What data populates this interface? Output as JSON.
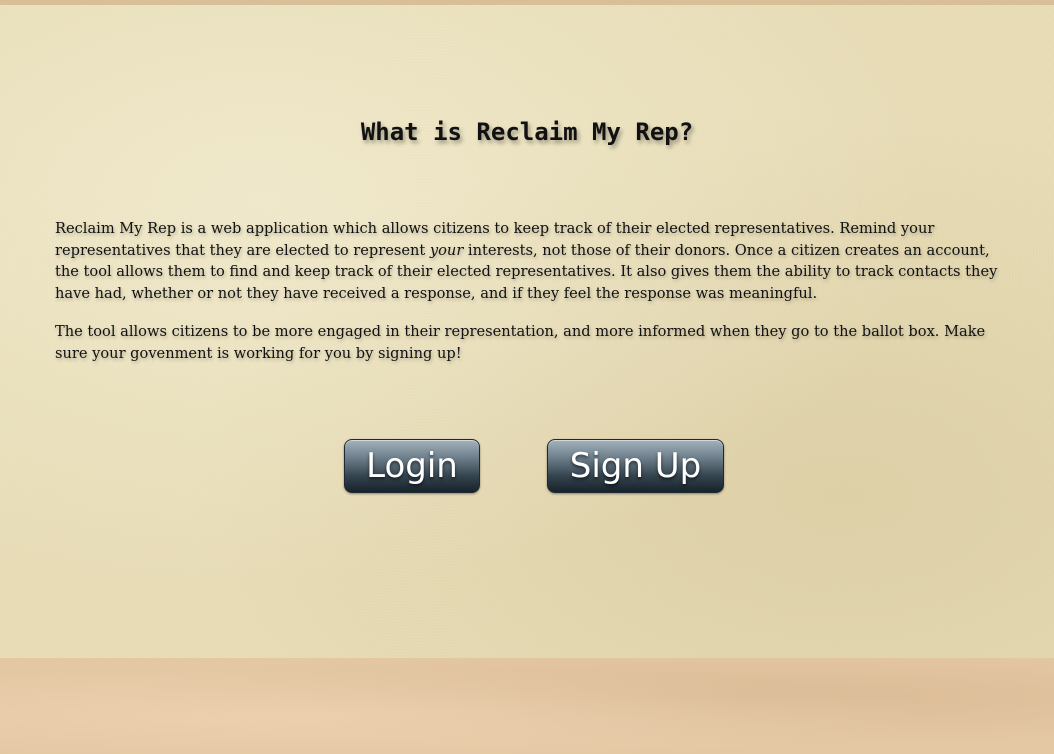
{
  "header": {
    "title": "What is Reclaim My Rep?"
  },
  "main": {
    "paragraph1": {
      "before_emphasis": "Reclaim My Rep is a web application which allows citizens to keep track of their elected representatives. Remind your representatives that they are elected to represent ",
      "emphasis": "your",
      "after_emphasis": " interests, not those of their donors. Once a citizen creates an account, the tool allows them to find and keep track of their elected representatives. It also gives them the ability to track contacts they have had, whether or not they have received a response, and if they feel the response was meaningful."
    },
    "paragraph2": "The tool allows citizens to be more engaged in their representation, and more informed when they go to the ballot box. Make sure your govenment is working for you by signing up!"
  },
  "actions": {
    "login_label": "Login",
    "signup_label": "Sign Up"
  },
  "colors": {
    "paper": "#e9deb8",
    "bottom_band": "#e4c7a3",
    "text": "#111111",
    "button_top": "#a4b2bc",
    "button_bottom": "#18222a",
    "button_text": "#ffffff"
  }
}
